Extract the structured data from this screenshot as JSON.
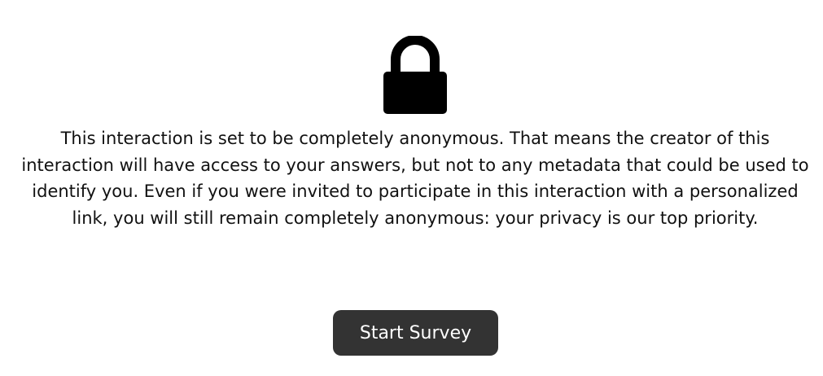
{
  "lock_icon": "lock-icon",
  "message": "This interaction is set to be completely anonymous. That means the creator of this interaction will have access to your answers, but not to any metadata that could be used to identify you. Even if you were invited to participate in this interaction with a personalized link, you will still remain completely anonymous: your privacy is our top priority.",
  "start_button": {
    "label": "Start Survey"
  },
  "colors": {
    "button_background": "#333333",
    "button_text": "#ffffff",
    "text": "#111111",
    "icon": "#000000"
  }
}
